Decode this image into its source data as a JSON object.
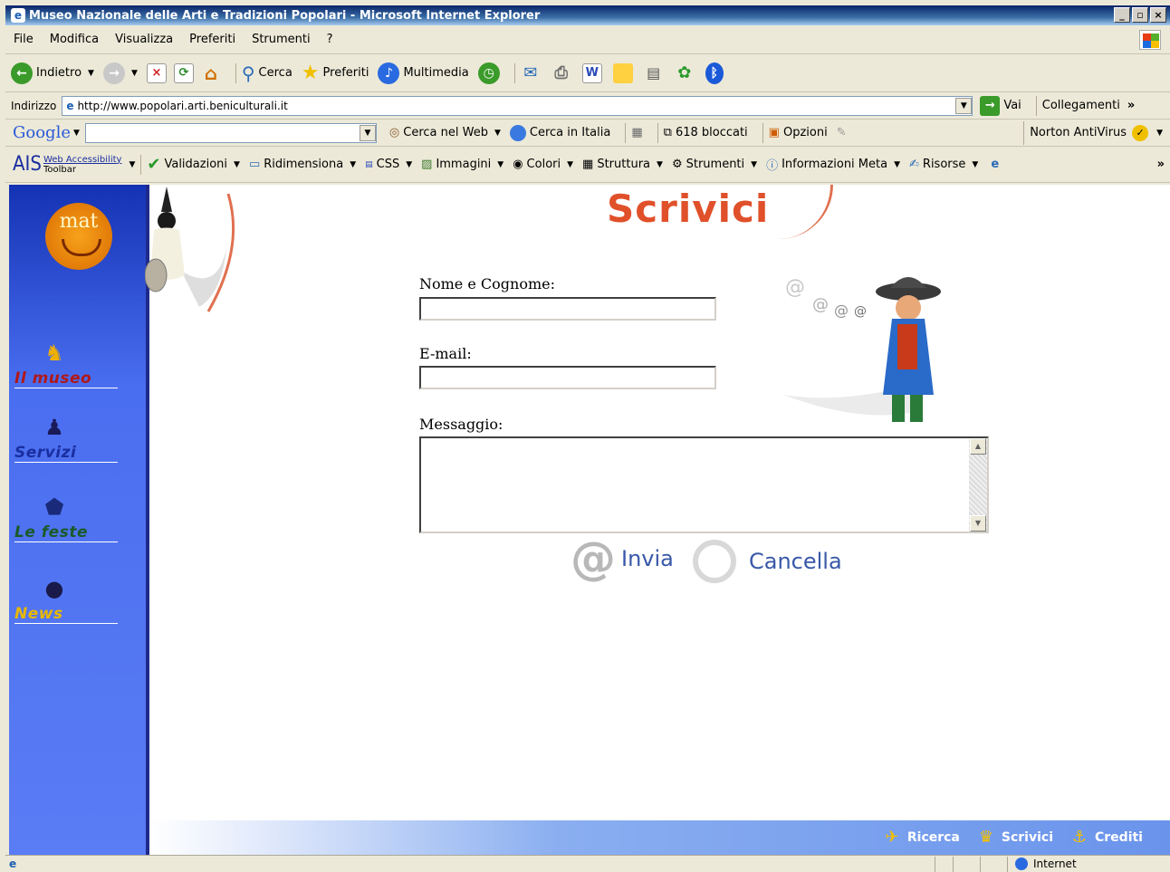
{
  "window": {
    "title": "Museo Nazionale delle Arti e Tradizioni Popolari - Microsoft Internet Explorer"
  },
  "menu": [
    "File",
    "Modifica",
    "Visualizza",
    "Preferiti",
    "Strumenti",
    "?"
  ],
  "toolbar": {
    "back": "Indietro",
    "search": "Cerca",
    "favorites": "Preferiti",
    "media": "Multimedia"
  },
  "address": {
    "label": "Indirizzo",
    "url": "http://www.popolari.arti.beniculturali.it",
    "go": "Vai",
    "links": "Collegamenti"
  },
  "google": {
    "logo": "Google",
    "search_web": "Cerca nel Web",
    "search_italy": "Cerca in Italia",
    "blocked": "618 bloccati",
    "options": "Opzioni",
    "norton": "Norton AntiVirus"
  },
  "ais": {
    "logo": "AIS",
    "title_top": "Web Accessibility",
    "title_bottom": "Toolbar",
    "items": [
      "Validazioni",
      "Ridimensiona",
      "CSS",
      "Immagini",
      "Colori",
      "Struttura",
      "Strumenti",
      "Informazioni Meta",
      "Risorse"
    ]
  },
  "page": {
    "logo": "mat",
    "title": "Scrivici",
    "nav": [
      {
        "label": "Il museo",
        "color": "#b01818"
      },
      {
        "label": "Servizi",
        "color": "#1a2ea0"
      },
      {
        "label": "Le feste",
        "color": "#1a5a2a"
      },
      {
        "label": "News",
        "color": "#e8b800"
      }
    ],
    "form": {
      "name_label": "Nome e Cognome:",
      "email_label": "E-mail:",
      "message_label": "Messaggio:",
      "name_value": "",
      "email_value": "",
      "message_value": "",
      "submit": "Invia",
      "reset": "Cancella"
    },
    "footer": [
      "Ricerca",
      "Scrivici",
      "Crediti"
    ]
  },
  "status": {
    "zone": "Internet"
  }
}
